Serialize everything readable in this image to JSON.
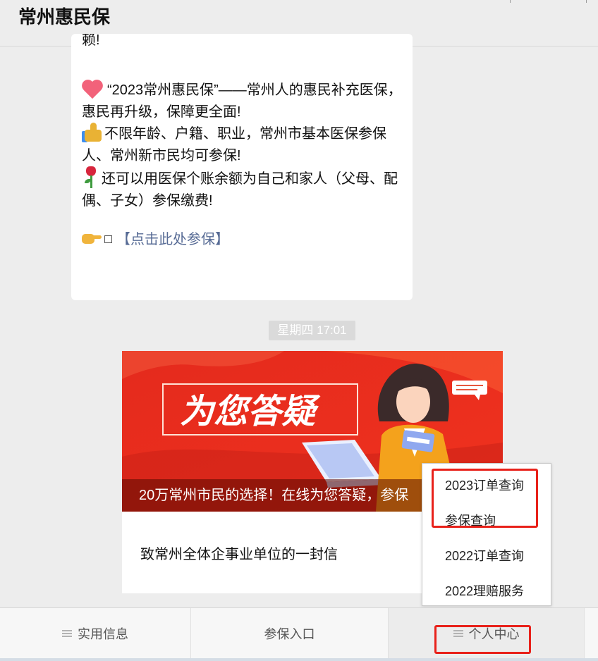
{
  "header": {
    "title": "常州惠民保"
  },
  "message": {
    "cut_line": "赖!",
    "line1": "“2023常州惠民保”——常州人的惠民补充医保，惠民再升级，保障更全面!",
    "line2": "不限年龄、户籍、职业，常州市基本医保参保人、常州新市民均可参保!",
    "line3": "还可以用医保个账余额为自己和家人（父母、配偶、子女）参保缴费!",
    "link_text": "【点击此处参保】",
    "icons": [
      "heart-emoji",
      "thumbs-up-emoji",
      "rose-emoji",
      "pointing-hand-emoji"
    ]
  },
  "timestamp": "星期四 17:01",
  "article": {
    "cover_headline": "为您答疑",
    "cover_title": "20万常州市民的选择！在线为您答疑，参保",
    "item2_title": "致常州全体企事业单位的一封信"
  },
  "popup_menu": {
    "items": [
      "2023订单查询",
      "参保查询",
      "2022订单查询",
      "2022理赔服务"
    ]
  },
  "bottom_menu": {
    "tabs": [
      "实用信息",
      "参保入口",
      "个人中心"
    ]
  },
  "colors": {
    "highlight": "#e8211a",
    "cover_red": "#e8281c",
    "link": "#576b95"
  }
}
